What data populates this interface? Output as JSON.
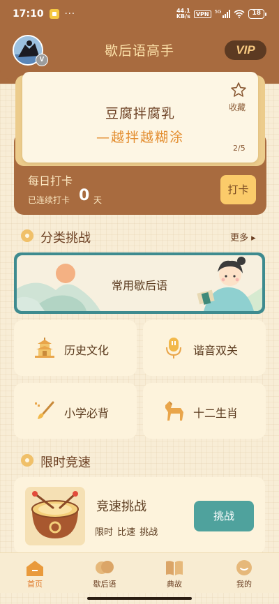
{
  "status_bar": {
    "time": "17:10",
    "dots": "···",
    "net_speed_value": "44.1",
    "net_speed_unit": "KB/s",
    "vpn": "VPN",
    "network": "5G",
    "battery": "18"
  },
  "header": {
    "title": "歇后语高手",
    "vip_label": "VIP",
    "avatar_badge": "V"
  },
  "word_card": {
    "question": "豆腐拌腐乳",
    "answer": "—越拌越糊涂",
    "favorite_label": "收藏",
    "page": "2/5"
  },
  "checkin": {
    "title": "每日打卡",
    "streak_prefix": "已连续打卡",
    "streak_days": "0",
    "streak_unit": "天",
    "button_label": "打卡"
  },
  "category_section": {
    "title": "分类挑战",
    "more_label": "更多 ▸",
    "banner_label": "常用歇后语",
    "items": [
      {
        "label": "历史文化",
        "icon": "pagoda-icon"
      },
      {
        "label": "谐音双关",
        "icon": "microphone-icon"
      },
      {
        "label": "小学必背",
        "icon": "brush-icon"
      },
      {
        "label": "十二生肖",
        "icon": "horse-icon"
      }
    ]
  },
  "speed_section": {
    "title": "限时竞速",
    "card_title": "竞速挑战",
    "card_subtitle": "限时 比速 挑战",
    "button_label": "挑战"
  },
  "tab_bar": {
    "tabs": [
      {
        "label": "首页",
        "icon": "home-icon",
        "active": true
      },
      {
        "label": "歇后语",
        "icon": "chat-bubble-icon",
        "active": false
      },
      {
        "label": "典故",
        "icon": "book-icon",
        "active": false
      },
      {
        "label": "我的",
        "icon": "profile-icon",
        "active": false
      }
    ]
  },
  "colors": {
    "brand_brown": "#a86b3f",
    "accent_orange": "#e38d2f",
    "teal": "#4fa29d",
    "gold": "#fbcb6a"
  }
}
